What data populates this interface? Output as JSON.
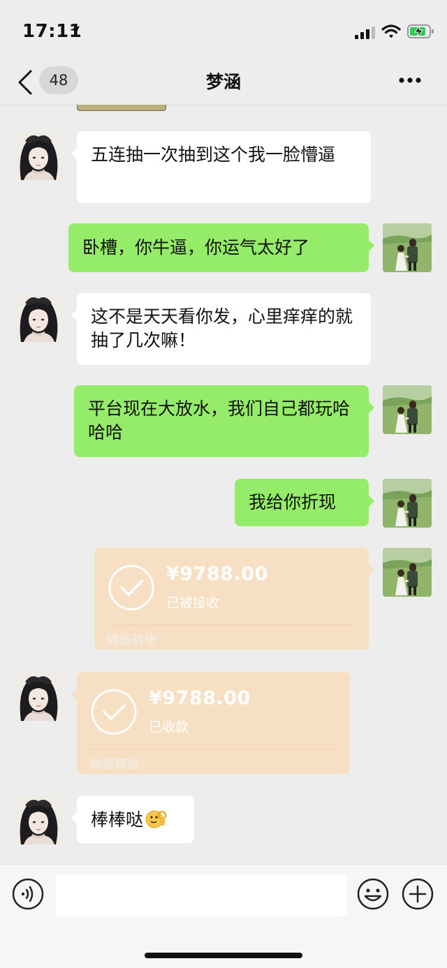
{
  "status_bar": {
    "time": "17:11"
  },
  "nav": {
    "unread_count": "48",
    "title": "梦涵"
  },
  "messages": [
    {
      "text": "五连抽一次抽到这个我一脸懵逼"
    },
    {
      "text": "卧槽，你牛逼，你运气太好了"
    },
    {
      "text": "这不是天天看你发，心里痒痒的就抽了几次嘛！"
    },
    {
      "text": "平台现在大放水，我们自己都玩哈哈哈"
    },
    {
      "text": "我给你折现"
    },
    {
      "amount": "¥9788.00",
      "status": "已被接收",
      "footer": "微信转账"
    },
    {
      "amount": "¥9788.00",
      "status": "已收款",
      "footer": "微信转账"
    },
    {
      "text": "棒棒哒"
    }
  ],
  "input": {
    "value": ""
  },
  "colors": {
    "incoming": "#ffffff",
    "outgoing": "#95ec69",
    "transfer": "#f7dfc4",
    "background": "#ededed"
  }
}
